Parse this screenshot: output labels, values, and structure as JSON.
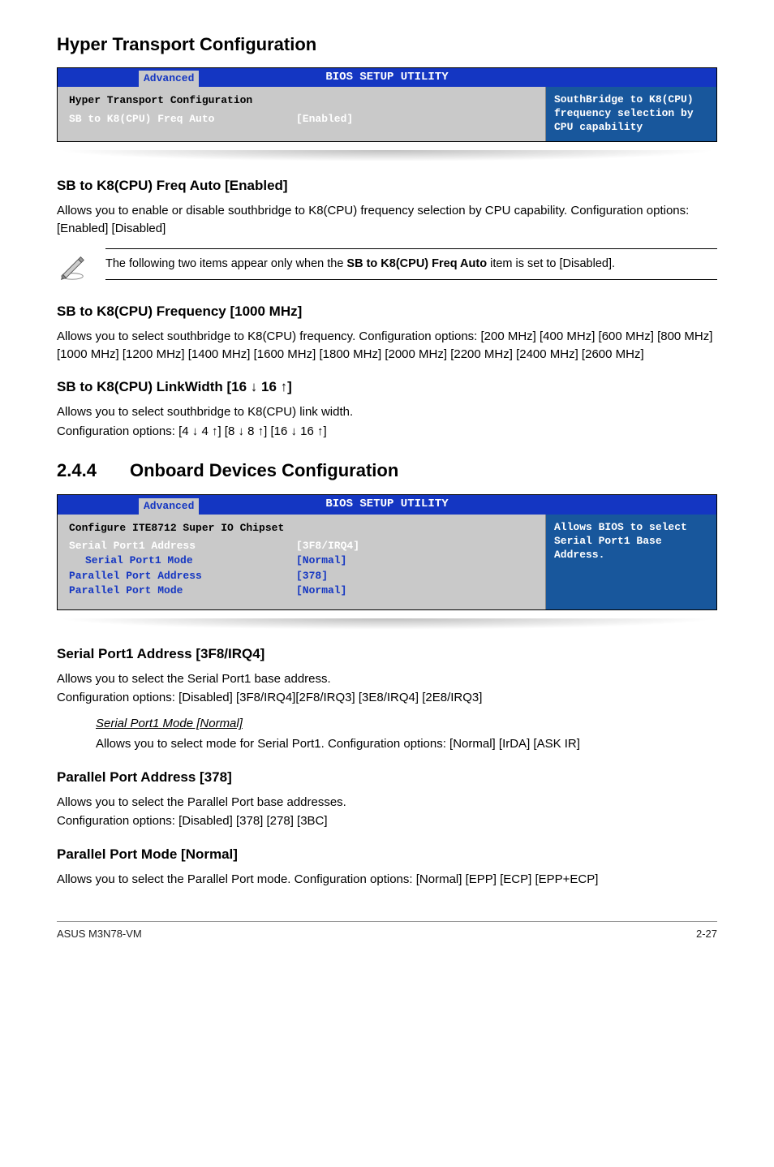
{
  "hyper": {
    "title": "Hyper Transport Configuration",
    "bios": {
      "titlebar": "BIOS SETUP UTILITY",
      "tab": "Advanced",
      "heading": "Hyper Transport Configuration",
      "rows": [
        {
          "label": "SB to K8(CPU) Freq Auto",
          "value": "[Enabled]",
          "white": true
        }
      ],
      "help": "SouthBridge to K8(CPU) frequency selection by CPU capability"
    },
    "sb_auto": {
      "head": "SB to K8(CPU) Freq Auto [Enabled]",
      "body": "Allows you to enable or disable southbridge to K8(CPU) frequency selection by CPU capability. Configuration options: [Enabled] [Disabled]"
    },
    "note": "The following two items appear only when the ",
    "note_bold": "SB to K8(CPU) Freq Auto",
    "note_tail": " item is set to [Disabled].",
    "sb_freq": {
      "head": "SB to K8(CPU) Frequency [1000 MHz]",
      "body": "Allows you to select  southbridge to K8(CPU) frequency. Configuration options: [200 MHz] [400 MHz] [600 MHz] [800 MHz] [1000 MHz] [1200 MHz] [1400 MHz] [1600 MHz] [1800 MHz] [2000 MHz] [2200 MHz] [2400 MHz] [2600 MHz]"
    },
    "sb_link": {
      "head": "SB to K8(CPU) LinkWidth [16 ↓ 16 ↑]",
      "body1": "Allows you to select southbridge to K8(CPU) link width.",
      "body2": "Configuration options: [4 ↓ 4 ↑] [8 ↓ 8 ↑] [16 ↓ 16 ↑]"
    }
  },
  "onboard": {
    "num": "2.4.4",
    "title": "Onboard Devices Configuration",
    "bios": {
      "titlebar": "BIOS SETUP UTILITY",
      "tab": "Advanced",
      "heading": "Configure ITE8712 Super IO Chipset",
      "rows": [
        {
          "label": "Serial Port1 Address",
          "value": "[3F8/IRQ4]",
          "white": true
        },
        {
          "label": "Serial Port1 Mode",
          "value": "[Normal]",
          "indent": true
        },
        {
          "label": "Parallel Port Address",
          "value": "[378]"
        },
        {
          "label": "Parallel Port Mode",
          "value": "[Normal]"
        }
      ],
      "help": "Allows BIOS to select Serial Port1 Base Address."
    },
    "serial_addr": {
      "head": "Serial Port1 Address [3F8/IRQ4]",
      "body1": "Allows you to select the Serial Port1 base address.",
      "body2": "Configuration options: [Disabled] [3F8/IRQ4][2F8/IRQ3] [3E8/IRQ4] [2E8/IRQ3]"
    },
    "serial_mode": {
      "head": "Serial Port1 Mode [Normal]",
      "body": "Allows you to select mode for Serial Port1. Configuration options: [Normal] [IrDA] [ASK IR]"
    },
    "par_addr": {
      "head": "Parallel Port Address [378]",
      "body1": "Allows you to select the Parallel Port base addresses.",
      "body2": "Configuration options: [Disabled] [378] [278] [3BC]"
    },
    "par_mode": {
      "head": "Parallel Port Mode [Normal]",
      "body": "Allows you to select the Parallel Port  mode. Configuration options: [Normal] [EPP] [ECP] [EPP+ECP]"
    }
  },
  "footer": {
    "left": "ASUS M3N78-VM",
    "right": "2-27"
  }
}
